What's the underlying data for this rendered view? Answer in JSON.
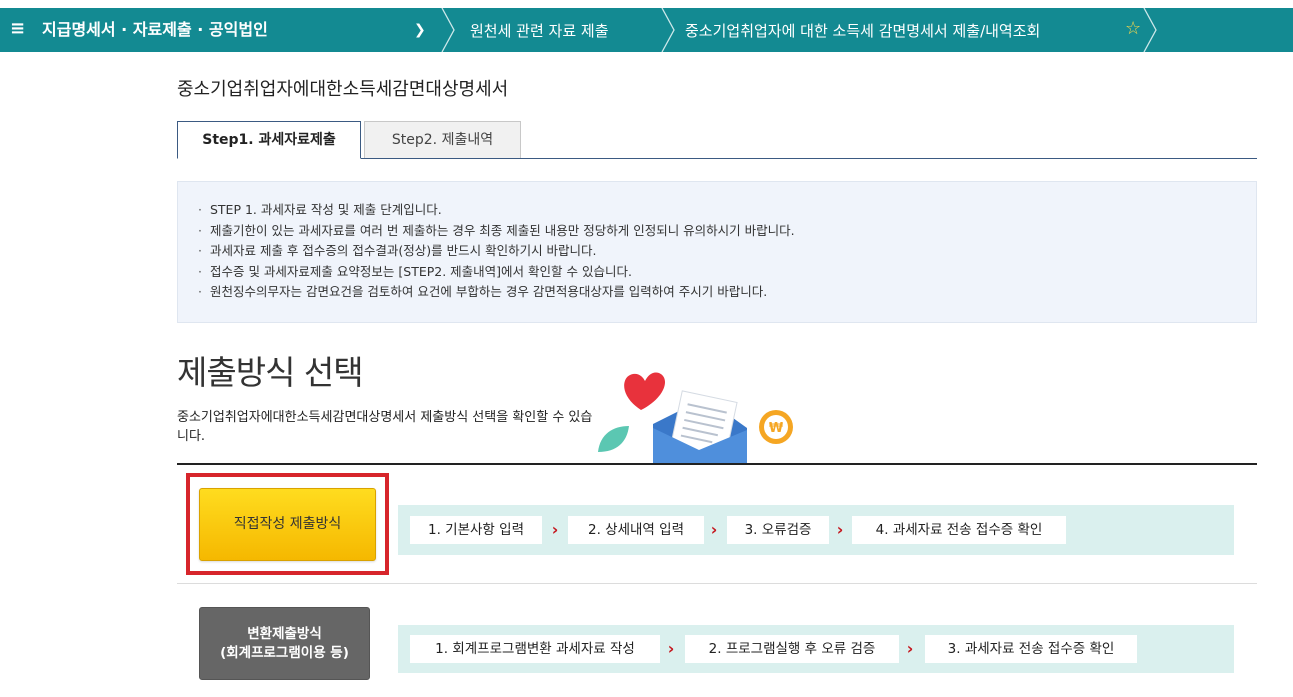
{
  "nav": {
    "menu_icon": "≡",
    "title": "지급명세서 · 자료제출 · 공익법인",
    "crumb1": "원천세 관련 자료 제출",
    "crumb2": "중소기업취업자에 대한 소득세 감면명세서 제출/내역조회",
    "star": "☆",
    "bg_color": "#138a92"
  },
  "page": {
    "title": "중소기업취업자에대한소득세감면대상명세서"
  },
  "tabs": [
    {
      "label": "Step1. 과세자료제출",
      "active": true
    },
    {
      "label": "Step2. 제출내역",
      "active": false
    }
  ],
  "info": [
    "STEP 1. 과세자료 작성 및 제출 단계입니다.",
    "제출기한이 있는 과세자료를 여러 번 제출하는 경우 최종 제출된 내용만 정당하게 인정되니 유의하시기 바랍니다.",
    "과세자료 제출 후 접수증의 접수결과(정상)를 반드시 확인하기시 바랍니다.",
    "접수증 및 과세자료제출 요약정보는 [STEP2. 제출내역]에서 확인할 수 있습니다.",
    "원천징수의무자는 감면요건을 검토하여 요건에 부합하는 경우 감면적용대상자를 입력하여 주시기 바랍니다."
  ],
  "section": {
    "heading": "제출방식 선택",
    "desc": "중소기업취업자에대한소득세감면대상명세서 제출방식 선택을 확인할 수 있습니다."
  },
  "methods": {
    "direct": {
      "label": "직접작성 제출방식",
      "steps": [
        "1. 기본사항 입력",
        "2. 상세내역 입력",
        "3. 오류검증",
        "4. 과세자료 전송 접수증 확인"
      ]
    },
    "convert": {
      "label_line1": "변환제출방식",
      "label_line2": "(회계프로그램이용 등)",
      "steps": [
        "1. 회계프로그램변환 과세자료 작성",
        "2. 프로그램실행 후 오류 검증",
        "3. 과세자료 전송 접수증 확인"
      ]
    },
    "arrow": "›"
  },
  "colors": {
    "highlight": "#d7252b",
    "direct_button": "#f5c400",
    "convert_button": "#666666",
    "steps_bg": "#daf0ee",
    "arrow": "#c5161d"
  }
}
